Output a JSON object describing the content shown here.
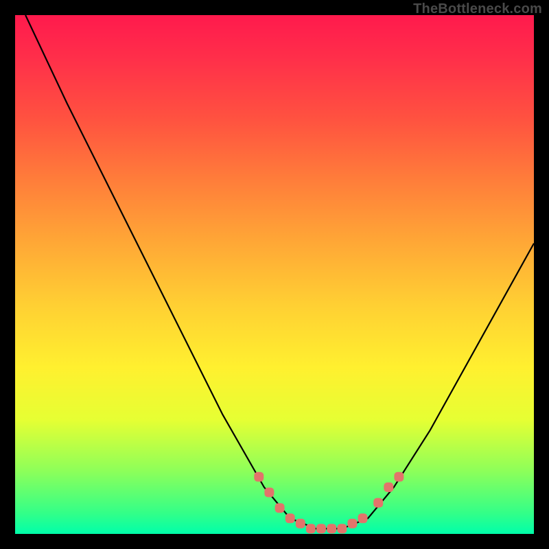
{
  "watermark": "TheBottleneck.com",
  "chart_data": {
    "type": "line",
    "title": "",
    "xlabel": "",
    "ylabel": "",
    "xlim": [
      0,
      100
    ],
    "ylim": [
      0,
      100
    ],
    "series": [
      {
        "name": "curve",
        "x": [
          2,
          10,
          20,
          30,
          40,
          48,
          53,
          58,
          63,
          68,
          73,
          80,
          90,
          100
        ],
        "values": [
          100,
          83,
          63,
          43,
          23,
          9,
          3,
          1,
          1,
          3,
          9,
          20,
          38,
          56
        ]
      }
    ],
    "markers": {
      "name": "highlighted-points",
      "color": "#e2746b",
      "x": [
        47,
        49,
        51,
        53,
        55,
        57,
        59,
        61,
        63,
        65,
        67,
        70,
        72,
        74
      ],
      "values": [
        11,
        8,
        5,
        3,
        2,
        1,
        1,
        1,
        1,
        2,
        3,
        6,
        9,
        11
      ]
    },
    "background_gradient": {
      "top_color": "#ff1a4d",
      "bottom_color": "#00ffaa"
    }
  }
}
